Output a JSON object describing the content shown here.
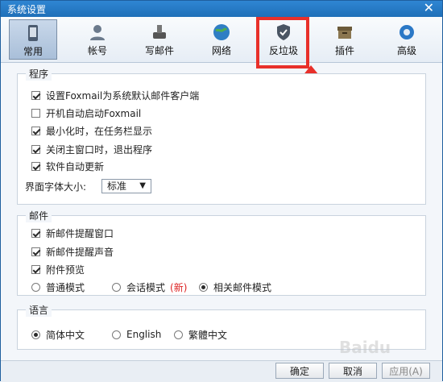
{
  "window": {
    "title": "系统设置"
  },
  "toolbar": {
    "tabs": [
      {
        "label": "常用",
        "icon": "phone-icon",
        "active": true
      },
      {
        "label": "帐号",
        "icon": "user-icon"
      },
      {
        "label": "写邮件",
        "icon": "pen-icon"
      },
      {
        "label": "网络",
        "icon": "globe-icon"
      },
      {
        "label": "反垃圾",
        "icon": "shield-check-icon"
      },
      {
        "label": "插件",
        "icon": "box-icon"
      },
      {
        "label": "高级",
        "icon": "gear-icon"
      }
    ]
  },
  "program": {
    "title": "程序",
    "options": [
      {
        "label": "设置Foxmail为系统默认邮件客户端",
        "checked": true
      },
      {
        "label": "开机自动启动Foxmail",
        "checked": false
      },
      {
        "label": "最小化时，在任务栏显示",
        "checked": true
      },
      {
        "label": "关闭主窗口时，退出程序",
        "checked": true
      },
      {
        "label": "软件自动更新",
        "checked": true
      }
    ],
    "font_size_label": "界面字体大小:",
    "font_size_value": "标准"
  },
  "mail": {
    "title": "邮件",
    "options": [
      {
        "label": "新邮件提醒窗口",
        "checked": true
      },
      {
        "label": "新邮件提醒声音",
        "checked": true
      },
      {
        "label": "附件预览",
        "checked": true
      }
    ],
    "modes": [
      {
        "label": "普通模式",
        "checked": false
      },
      {
        "label": "会话模式",
        "checked": false,
        "badge": "(新)"
      },
      {
        "label": "相关邮件模式",
        "checked": true
      }
    ]
  },
  "language": {
    "title": "语言",
    "options": [
      {
        "label": "简体中文",
        "checked": true
      },
      {
        "label": "English",
        "checked": false
      },
      {
        "label": "繁體中文",
        "checked": false
      }
    ]
  },
  "buttons": {
    "ok": "确定",
    "cancel": "取消",
    "apply": "应用(A)"
  },
  "colors": {
    "highlight": "#e8302a",
    "titlebar": "#1f6fb8"
  }
}
